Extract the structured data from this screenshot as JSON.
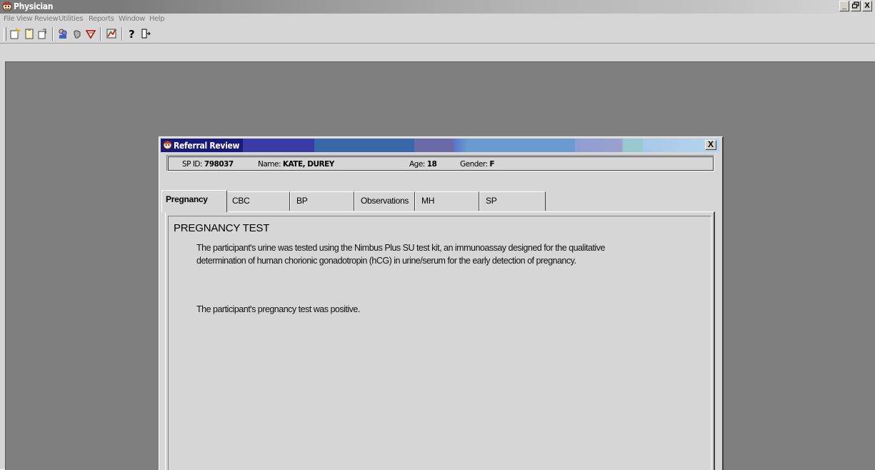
{
  "app": {
    "title": "Physician",
    "window_buttons": [
      "_",
      "□",
      "X"
    ]
  },
  "menu": [
    {
      "label": "File"
    },
    {
      "label": "View"
    },
    {
      "label": "Review"
    },
    {
      "label": "Utilities"
    },
    {
      "label": "Reports"
    },
    {
      "label": "Window"
    },
    {
      "label": "Help"
    }
  ],
  "toolbar": {
    "icons": [
      "new-icon",
      "clipboard-icon",
      "document-icon",
      "people-icon",
      "hand-icon",
      "flag-icon",
      "chart-icon",
      "help-icon",
      "exit-icon"
    ]
  },
  "dialog": {
    "title": "Referral Review",
    "close_label": "X",
    "info": {
      "sp_id_label": "SP ID:",
      "sp_id": "798037",
      "name_label": "Name:",
      "name": "KATE, DUREY",
      "age_label": "Age:",
      "age": "18",
      "gender_label": "Gender:",
      "gender": "F"
    },
    "tabs": [
      {
        "label": "Pregnancy",
        "active": true
      },
      {
        "label": "CBC"
      },
      {
        "label": "BP"
      },
      {
        "label": "Observations"
      },
      {
        "label": "MH"
      },
      {
        "label": "SP"
      }
    ],
    "section_title": "PREGNANCY TEST",
    "paragraphs": [
      "The participant's urine was tested using the Nimbus Plus SU test kit, an immunoassay designed for the qualitative determination of human chorionic gonadotropin (hCG) in urine/serum for the early detection of pregnancy.",
      "The participant's pregnancy test was positive."
    ]
  }
}
